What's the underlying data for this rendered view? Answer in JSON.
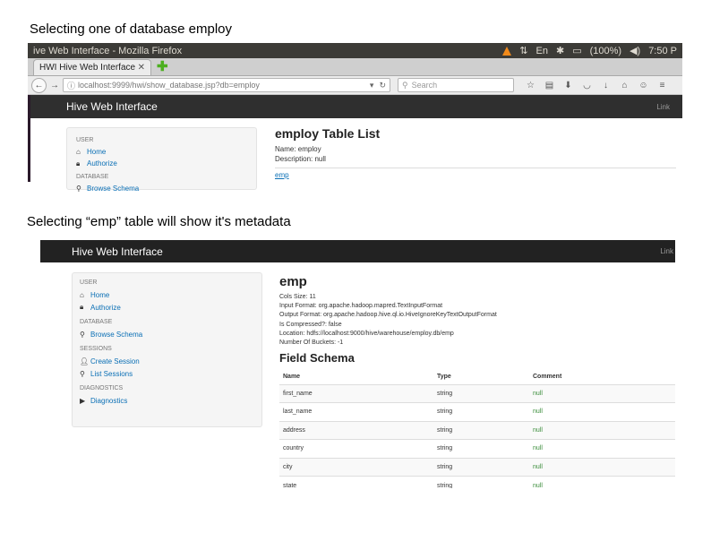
{
  "captions": {
    "first": "Selecting one of database employ",
    "second": "Selecting “emp” table will show it's metadata"
  },
  "browser": {
    "window_title": "ive Web Interface - Mozilla Firefox",
    "tab_label": "HWI Hive Web Interface",
    "url": "localhost:9999/hwi/show_database.jsp?db=employ",
    "search_placeholder": "Search",
    "battery": "(100%)",
    "clock": "7:50 P",
    "keyboard_indicator": "En"
  },
  "screen1": {
    "brand": "Hive Web Interface",
    "header_link": "Link",
    "sidebar": [
      {
        "heading": "USER",
        "items": [
          {
            "label": "Home",
            "icon": "home-icon"
          },
          {
            "label": "Authorize",
            "icon": "lock-icon"
          }
        ]
      },
      {
        "heading": "DATABASE",
        "items": [
          {
            "label": "Browse Schema",
            "icon": "search-icon"
          }
        ]
      }
    ],
    "title": "employ Table List",
    "name_line": "Name: employ",
    "description_line": "Description: null",
    "tables": [
      "emp"
    ]
  },
  "screen2": {
    "brand": "Hive Web Interface",
    "header_link": "Link",
    "sidebar": [
      {
        "heading": "USER",
        "items": [
          {
            "label": "Home",
            "icon": "home-icon"
          },
          {
            "label": "Authorize",
            "icon": "lock-icon"
          }
        ]
      },
      {
        "heading": "DATABASE",
        "items": [
          {
            "label": "Browse Schema",
            "icon": "search-icon"
          }
        ]
      },
      {
        "heading": "SESSIONS",
        "items": [
          {
            "label": "Create Session",
            "icon": "user-icon"
          },
          {
            "label": "List Sessions",
            "icon": "search-icon"
          }
        ]
      },
      {
        "heading": "DIAGNOSTICS",
        "items": [
          {
            "label": "Diagnostics",
            "icon": "play-icon"
          }
        ]
      }
    ],
    "table_name": "emp",
    "metadata": [
      "Cols Size: 11",
      "Input Format: org.apache.hadoop.mapred.TextInputFormat",
      "Output Format: org.apache.hadoop.hive.ql.io.HiveIgnoreKeyTextOutputFormat",
      "Is Compressed?: false",
      "Location: hdfs://localhost:9000/hive/warehouse/employ.db/emp",
      "Number Of Buckets: -1"
    ],
    "schema_title": "Field Schema",
    "columns": {
      "name": "Name",
      "type": "Type",
      "comment": "Comment"
    },
    "rows": [
      {
        "name": "first_name",
        "type": "string",
        "comment": "null"
      },
      {
        "name": "last_name",
        "type": "string",
        "comment": "null"
      },
      {
        "name": "address",
        "type": "string",
        "comment": "null"
      },
      {
        "name": "country",
        "type": "string",
        "comment": "null"
      },
      {
        "name": "city",
        "type": "string",
        "comment": "null"
      },
      {
        "name": "state",
        "type": "string",
        "comment": "null"
      }
    ]
  }
}
